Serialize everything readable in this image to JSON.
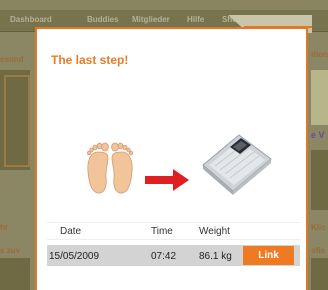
{
  "nav": {
    "items": [
      "Dashboard",
      "Buddies",
      "Mitglieder",
      "Hilfe",
      "Shop"
    ]
  },
  "background": {
    "left_texts": [
      "esund",
      "hr",
      "s zuv"
    ],
    "right_texts": [
      "ition",
      "e V",
      "Klic",
      "ofis"
    ]
  },
  "modal": {
    "title": "The last step!",
    "icons": [
      "feet-icon",
      "arrow-right-icon",
      "scale-icon"
    ],
    "table": {
      "columns": [
        "Date",
        "Time",
        "Weight"
      ],
      "rows": [
        {
          "date": "15/05/2009",
          "time": "07:42",
          "weight": "86.1 kg",
          "action": "Link"
        }
      ]
    }
  },
  "colors": {
    "accent": "#e67c29",
    "button": "#ee7a22",
    "row_bg": "#d3d3d3",
    "arrow": "#e02020"
  }
}
